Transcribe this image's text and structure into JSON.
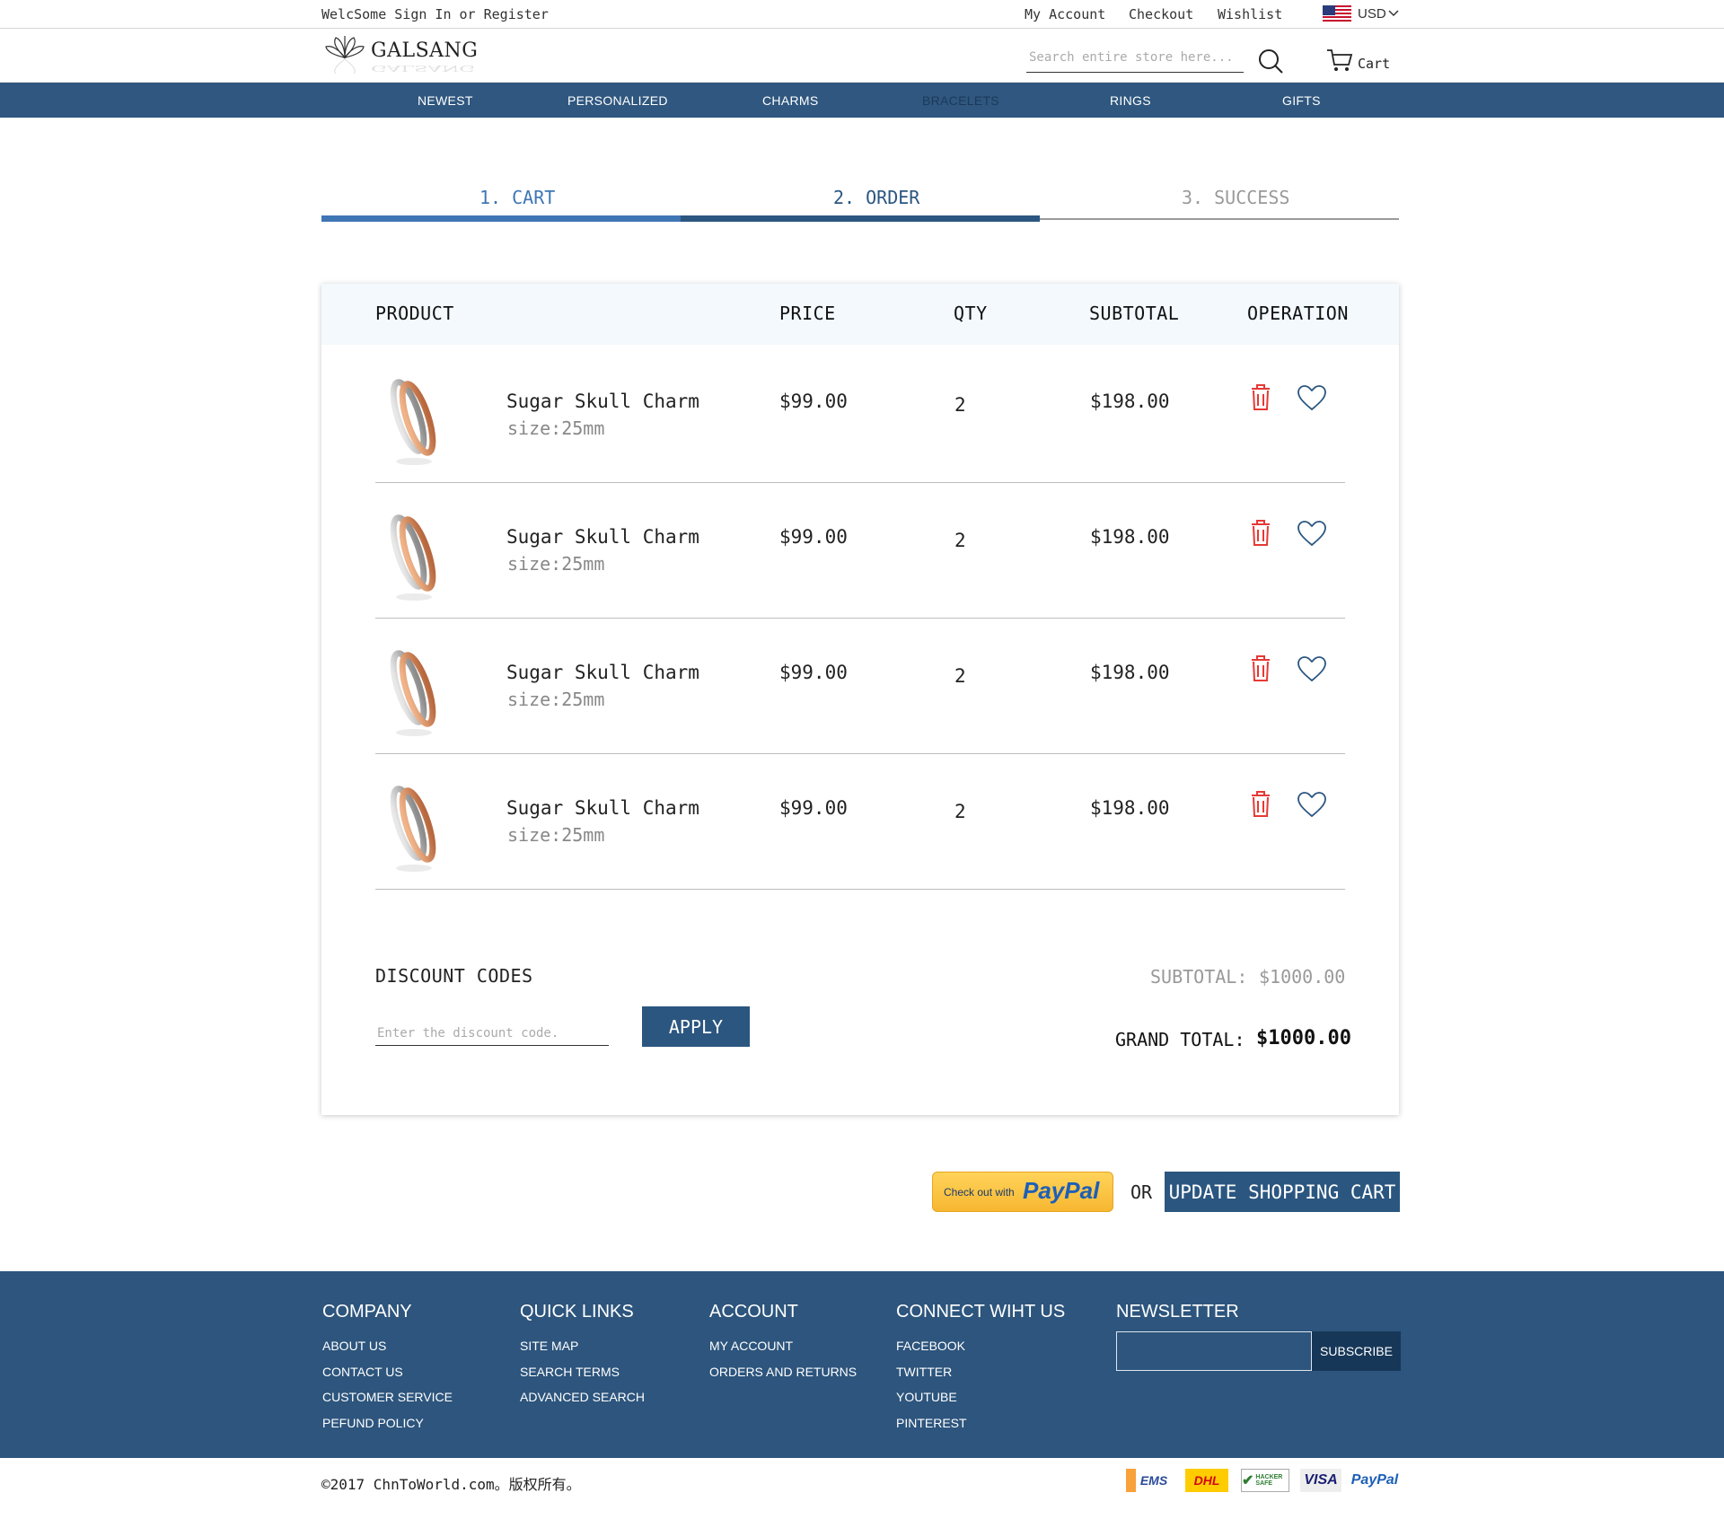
{
  "topbar": {
    "welcome": "WelcSome Sign In or Register",
    "my_account": "My Account",
    "checkout": "Checkout",
    "wishlist": "Wishlist",
    "currency": "USD"
  },
  "header": {
    "logo": "GALSANG",
    "search_placeholder": "Search entire store here...",
    "cart_label": "Cart"
  },
  "nav": {
    "items": [
      "NEWEST",
      "PERSONALIZED",
      "CHARMS",
      "BRACELETS",
      "RINGS",
      "GIFTS"
    ],
    "active": "BRACELETS"
  },
  "steps": [
    "1. CART",
    "2. ORDER",
    "3. SUCCESS"
  ],
  "table": {
    "headers": [
      "PRODUCT",
      "PRICE",
      "QTY",
      "SUBTOTAL",
      "OPERATION"
    ],
    "rows": [
      {
        "name": "Sugar Skull Charm",
        "size": "size:25mm",
        "price": "$99.00",
        "qty": "2",
        "subtotal": "$198.00"
      },
      {
        "name": "Sugar Skull Charm",
        "size": "size:25mm",
        "price": "$99.00",
        "qty": "2",
        "subtotal": "$198.00"
      },
      {
        "name": "Sugar Skull Charm",
        "size": "size:25mm",
        "price": "$99.00",
        "qty": "2",
        "subtotal": "$198.00"
      },
      {
        "name": "Sugar Skull Charm",
        "size": "size:25mm",
        "price": "$99.00",
        "qty": "2",
        "subtotal": "$198.00"
      }
    ]
  },
  "discount": {
    "title": "DISCOUNT CODES",
    "placeholder": "Enter the discount code.",
    "apply": "APPLY"
  },
  "totals": {
    "subtotal_label": "SUBTOTAL:",
    "subtotal_value": "$1000.00",
    "grand_label": "GRAND TOTAL:",
    "grand_value": "$1000.00"
  },
  "actions": {
    "paypal_prefix": "Check out with",
    "paypal_brand": "PayPal",
    "or": "OR",
    "update": "UPDATE SHOPPING CART"
  },
  "footer": {
    "columns": [
      {
        "title": "COMPANY",
        "links": [
          "ABOUT US",
          "CONTACT US",
          "CUSTOMER SERVICE",
          "PEFUND POLICY"
        ]
      },
      {
        "title": "QUICK LINKS",
        "links": [
          "SITE MAP",
          "SEARCH TERMS",
          "ADVANCED SEARCH"
        ]
      },
      {
        "title": "ACCOUNT",
        "links": [
          "MY ACCOUNT",
          "ORDERS AND RETURNS"
        ]
      },
      {
        "title": "CONNECT WIHT US",
        "links": [
          "FACEBOOK",
          "TWITTER",
          "YOUTUBE",
          "PINTEREST"
        ]
      }
    ],
    "newsletter_title": "NEWSLETTER",
    "subscribe": "SUBSCRIBE",
    "copyright": "©2017 ChnToWorld.com。版权所有。",
    "payment_icons": [
      "EMS",
      "DHL",
      "HACKER SAFE",
      "VISA",
      "PayPal"
    ]
  },
  "colors": {
    "primary": "#2f577f",
    "accent_red": "#e53935",
    "step_active": "#3f76b4"
  }
}
